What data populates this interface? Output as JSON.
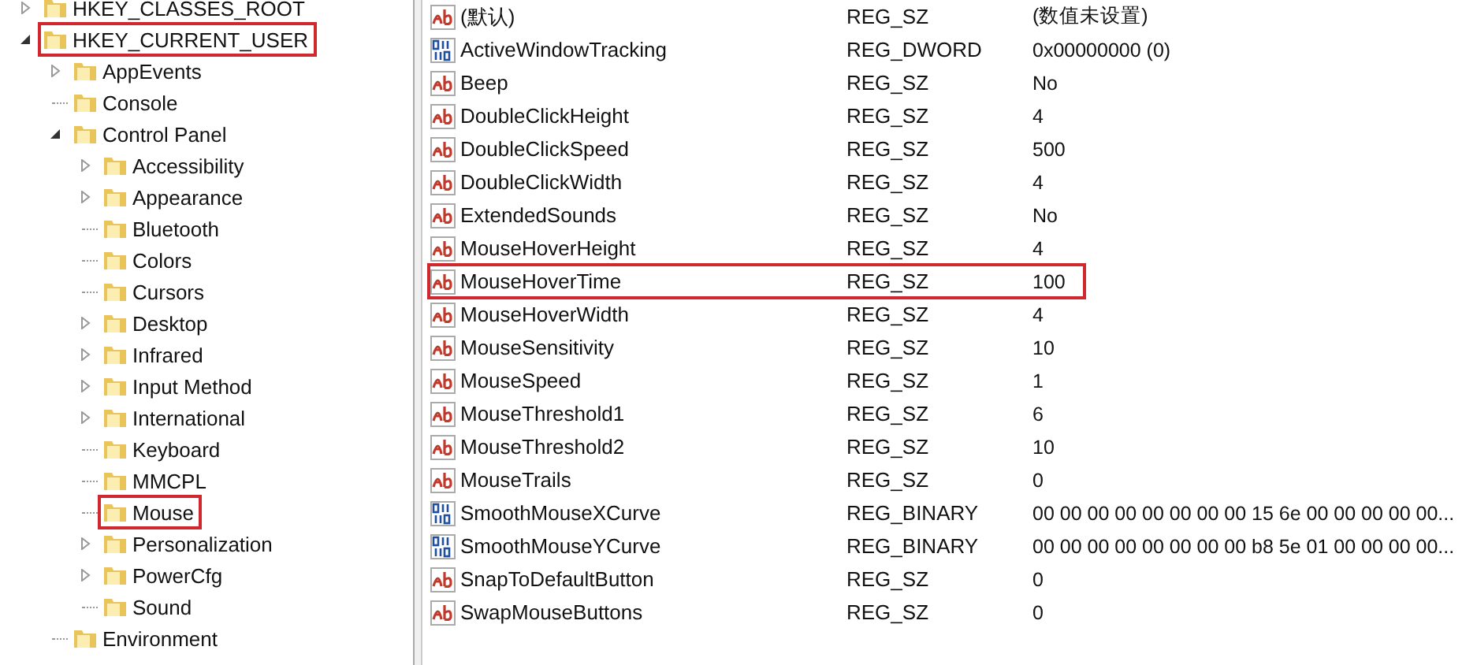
{
  "tree": [
    {
      "label": "HKEY_CLASSES_ROOT",
      "expanded": false,
      "highlighted": false
    },
    {
      "label": "HKEY_CURRENT_USER",
      "expanded": true,
      "highlighted": true,
      "children": [
        {
          "label": "AppEvents",
          "expanded": false,
          "highlighted": false
        },
        {
          "label": "Console",
          "highlighted": false
        },
        {
          "label": "Control Panel",
          "expanded": true,
          "highlighted": false,
          "children": [
            {
              "label": "Accessibility",
              "expanded": false,
              "highlighted": false
            },
            {
              "label": "Appearance",
              "expanded": false,
              "highlighted": false
            },
            {
              "label": "Bluetooth",
              "highlighted": false
            },
            {
              "label": "Colors",
              "highlighted": false
            },
            {
              "label": "Cursors",
              "highlighted": false
            },
            {
              "label": "Desktop",
              "expanded": false,
              "highlighted": false
            },
            {
              "label": "Infrared",
              "expanded": false,
              "highlighted": false
            },
            {
              "label": "Input Method",
              "expanded": false,
              "highlighted": false
            },
            {
              "label": "International",
              "expanded": false,
              "highlighted": false
            },
            {
              "label": "Keyboard",
              "highlighted": false
            },
            {
              "label": "MMCPL",
              "highlighted": false
            },
            {
              "label": "Mouse",
              "highlighted": true
            },
            {
              "label": "Personalization",
              "expanded": false,
              "highlighted": false
            },
            {
              "label": "PowerCfg",
              "expanded": false,
              "highlighted": false
            },
            {
              "label": "Sound",
              "highlighted": false
            }
          ]
        },
        {
          "label": "Environment",
          "highlighted": false
        }
      ]
    }
  ],
  "values": [
    {
      "kind": "string",
      "name": "(默认)",
      "type": "REG_SZ",
      "data": "(数值未设置)",
      "highlighted": false
    },
    {
      "kind": "binary",
      "name": "ActiveWindowTracking",
      "type": "REG_DWORD",
      "data": "0x00000000 (0)",
      "highlighted": false
    },
    {
      "kind": "string",
      "name": "Beep",
      "type": "REG_SZ",
      "data": "No",
      "highlighted": false
    },
    {
      "kind": "string",
      "name": "DoubleClickHeight",
      "type": "REG_SZ",
      "data": "4",
      "highlighted": false
    },
    {
      "kind": "string",
      "name": "DoubleClickSpeed",
      "type": "REG_SZ",
      "data": "500",
      "highlighted": false
    },
    {
      "kind": "string",
      "name": "DoubleClickWidth",
      "type": "REG_SZ",
      "data": "4",
      "highlighted": false
    },
    {
      "kind": "string",
      "name": "ExtendedSounds",
      "type": "REG_SZ",
      "data": "No",
      "highlighted": false
    },
    {
      "kind": "string",
      "name": "MouseHoverHeight",
      "type": "REG_SZ",
      "data": "4",
      "highlighted": false
    },
    {
      "kind": "string",
      "name": "MouseHoverTime",
      "type": "REG_SZ",
      "data": "100",
      "highlighted": true
    },
    {
      "kind": "string",
      "name": "MouseHoverWidth",
      "type": "REG_SZ",
      "data": "4",
      "highlighted": false
    },
    {
      "kind": "string",
      "name": "MouseSensitivity",
      "type": "REG_SZ",
      "data": "10",
      "highlighted": false
    },
    {
      "kind": "string",
      "name": "MouseSpeed",
      "type": "REG_SZ",
      "data": "1",
      "highlighted": false
    },
    {
      "kind": "string",
      "name": "MouseThreshold1",
      "type": "REG_SZ",
      "data": "6",
      "highlighted": false
    },
    {
      "kind": "string",
      "name": "MouseThreshold2",
      "type": "REG_SZ",
      "data": "10",
      "highlighted": false
    },
    {
      "kind": "string",
      "name": "MouseTrails",
      "type": "REG_SZ",
      "data": "0",
      "highlighted": false
    },
    {
      "kind": "binary",
      "name": "SmoothMouseXCurve",
      "type": "REG_BINARY",
      "data": "00 00 00 00 00 00 00 00 15 6e 00 00 00 00 00...",
      "highlighted": false
    },
    {
      "kind": "binary",
      "name": "SmoothMouseYCurve",
      "type": "REG_BINARY",
      "data": "00 00 00 00 00 00 00 00 b8 5e 01 00 00 00 00...",
      "highlighted": false
    },
    {
      "kind": "string",
      "name": "SnapToDefaultButton",
      "type": "REG_SZ",
      "data": "0",
      "highlighted": false
    },
    {
      "kind": "string",
      "name": "SwapMouseButtons",
      "type": "REG_SZ",
      "data": "0",
      "highlighted": false
    }
  ]
}
